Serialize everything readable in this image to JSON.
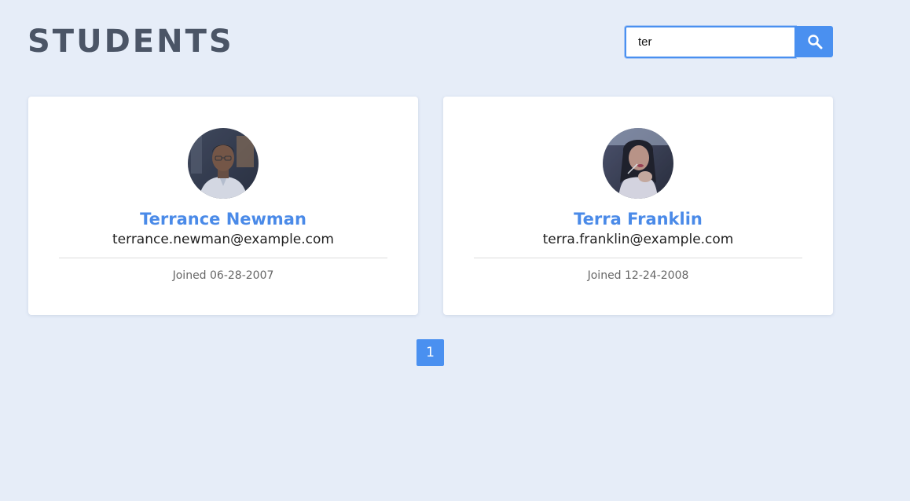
{
  "header": {
    "title": "STUDENTS"
  },
  "search": {
    "value": "ter",
    "icon": "search-icon"
  },
  "students": [
    {
      "name": "Terrance Newman",
      "email": "terrance.newman@example.com",
      "joined": "Joined 06-28-2007",
      "avatar": "avatar-photo"
    },
    {
      "name": "Terra Franklin",
      "email": "terra.franklin@example.com",
      "joined": "Joined 12-24-2008",
      "avatar": "avatar-photo"
    }
  ],
  "pagination": {
    "pages": [
      "1"
    ],
    "current": "1"
  },
  "colors": {
    "background": "#e6edf8",
    "accent": "#4a90f0",
    "name": "#4a8ae8",
    "title": "#4b5566"
  }
}
